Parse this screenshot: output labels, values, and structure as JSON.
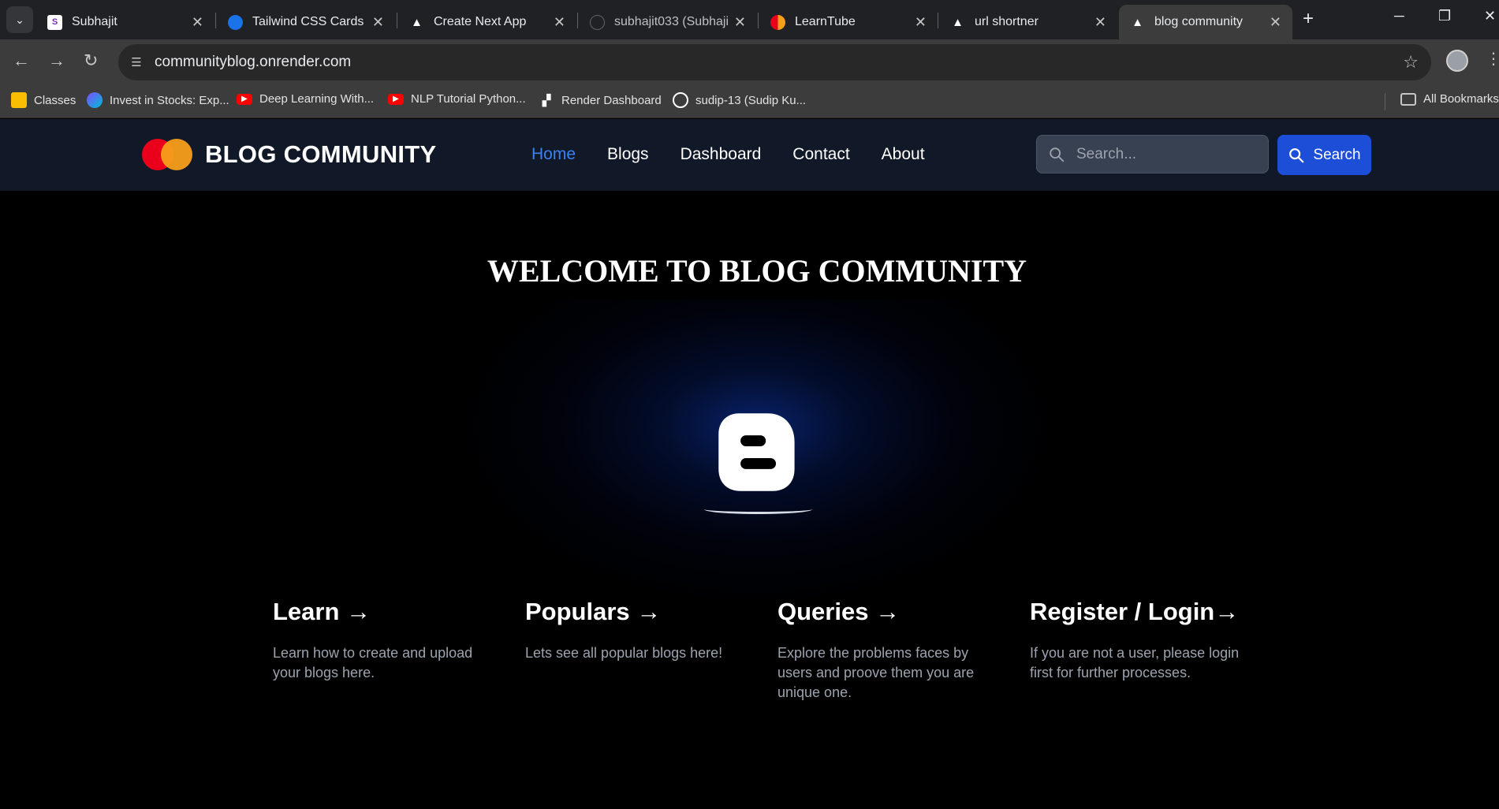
{
  "browser": {
    "tabs": [
      {
        "title": "Subhajit",
        "favicon_color": "#ffffff",
        "favicon_glyph": "S"
      },
      {
        "title": "Tailwind CSS Cards - ",
        "favicon_color": "#1a73e8",
        "favicon_glyph": ""
      },
      {
        "title": "Create Next App",
        "favicon_color": "#ffffff",
        "favicon_glyph": "▲"
      },
      {
        "title": "subhajit033 (Subhajit",
        "favicon_color": "#202124",
        "favicon_glyph": ""
      },
      {
        "title": "LearnTube",
        "favicon_color": "#f79e1b",
        "favicon_glyph": ""
      },
      {
        "title": "url shortner",
        "favicon_color": "#ffffff",
        "favicon_glyph": "▲"
      },
      {
        "title": "blog community",
        "favicon_color": "#ffffff",
        "favicon_glyph": "▲"
      }
    ],
    "active_tab_index": 6,
    "address": "communityblog.onrender.com",
    "bookmarks": [
      {
        "label": "Classes",
        "icon_color": "#fbbc04",
        "icon": "classroom-icon"
      },
      {
        "label": "Invest in Stocks: Exp...",
        "icon_color": "#7c4dff",
        "icon": "globe-icon"
      },
      {
        "label": "Deep Learning With...",
        "icon_color": "#ff0000",
        "icon": "youtube-icon"
      },
      {
        "label": "NLP Tutorial Python...",
        "icon_color": "#ff0000",
        "icon": "youtube-icon"
      },
      {
        "label": "Render Dashboard",
        "icon_color": "#ffffff",
        "icon": "render-icon"
      },
      {
        "label": "sudip-13 (Sudip Ku...",
        "icon_color": "#ffffff",
        "icon": "github-icon"
      }
    ],
    "all_bookmarks_label": "All Bookmarks"
  },
  "site": {
    "brand": "BLOG COMMUNITY",
    "nav": [
      {
        "label": "Home",
        "active": true
      },
      {
        "label": "Blogs",
        "active": false
      },
      {
        "label": "Dashboard",
        "active": false
      },
      {
        "label": "Contact",
        "active": false
      },
      {
        "label": "About",
        "active": false
      }
    ],
    "search_placeholder": "Search...",
    "search_button": "Search",
    "accent_color": "#1d4ed8",
    "active_link_color": "#3b82f6"
  },
  "hero": {
    "title": "WELCOME TO BLOG COMMUNITY",
    "icon": "blogger-icon"
  },
  "cards": [
    {
      "title": "Learn →",
      "text": "Learn how to create and upload your blogs here."
    },
    {
      "title": "Populars →",
      "text": "Lets see all popular blogs  here!"
    },
    {
      "title": "Queries →",
      "text": "Explore the problems faces by users and proove them you are unique one."
    },
    {
      "title": "Register / Login→",
      "text": "If you are not a user, please login first for further processes."
    }
  ]
}
